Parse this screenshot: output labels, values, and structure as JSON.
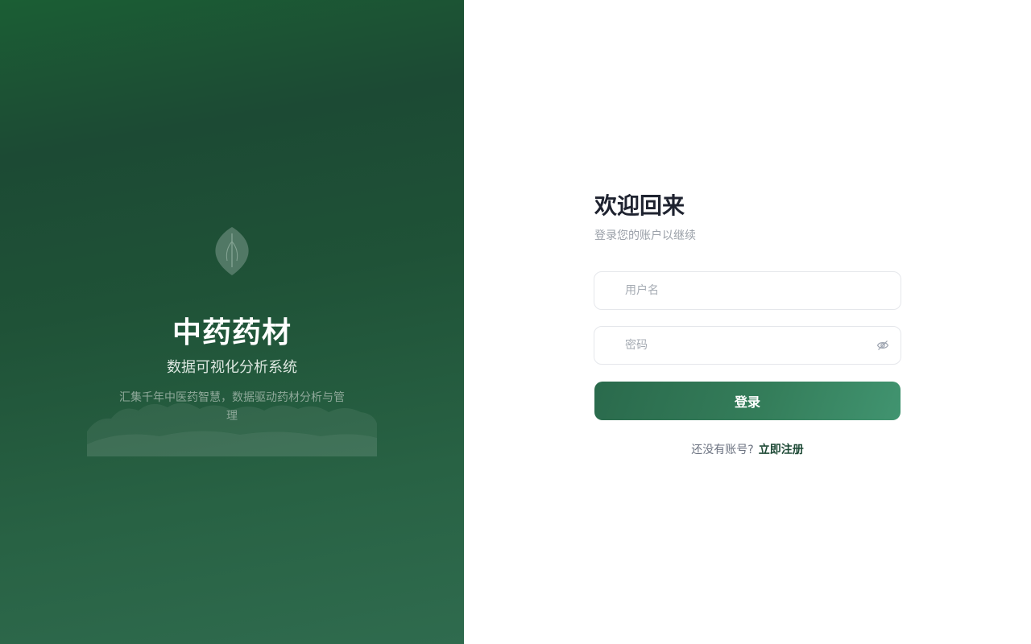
{
  "brand": {
    "title": "中药药材",
    "subtitle": "数据可视化分析系统",
    "description": "汇集千年中医药智慧，数据驱动药材分析与管理",
    "accent_color": "#1c4a34",
    "icon": "leaf-icon"
  },
  "login": {
    "title": "欢迎回来",
    "subtitle": "登录您的账户以继续",
    "username": {
      "placeholder": "用户名",
      "value": ""
    },
    "password": {
      "placeholder": "密码",
      "value": "",
      "toggle_icon": "eye-off-icon"
    },
    "submit_label": "登录",
    "signup_prompt": "还没有账号?",
    "signup_link": "立即注册",
    "button_color": "#347d5a"
  }
}
